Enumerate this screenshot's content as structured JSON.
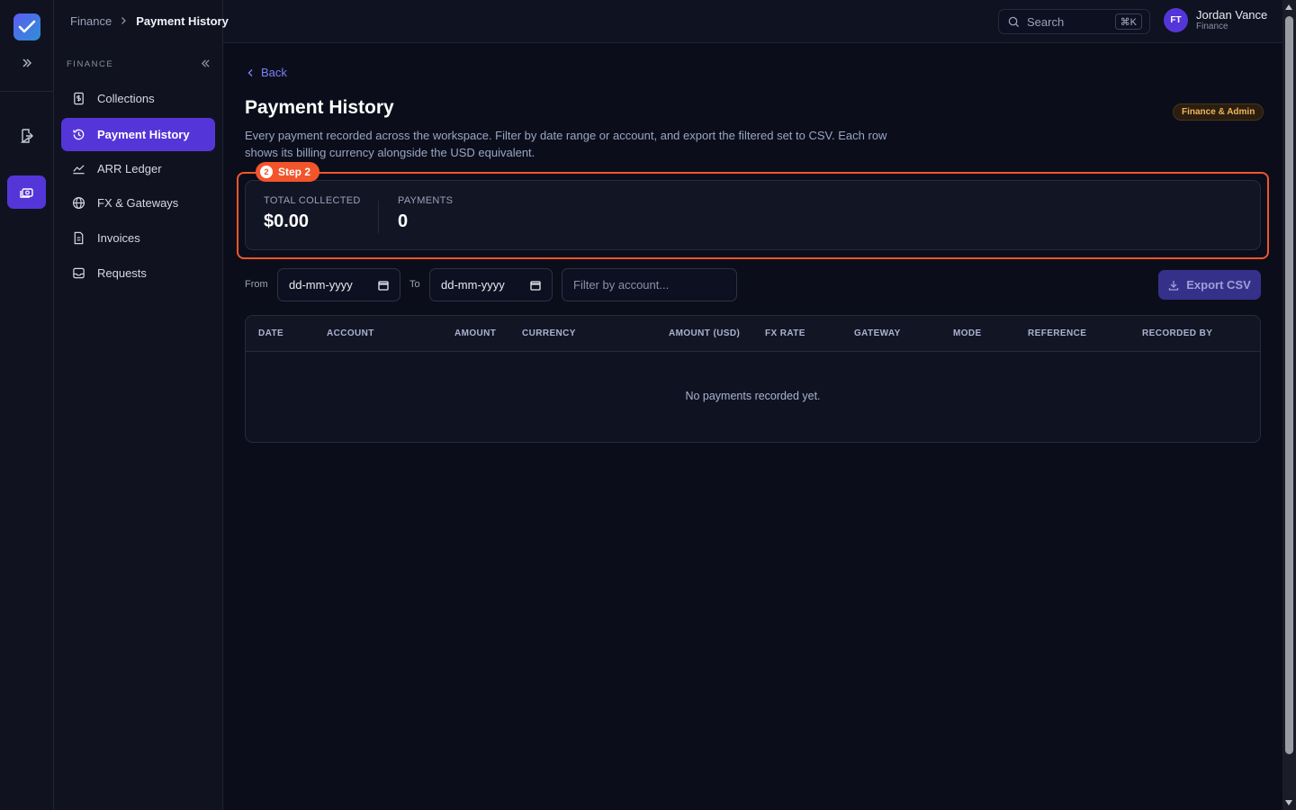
{
  "breadcrumb": {
    "parent": "Finance",
    "separator": ">",
    "current": "Payment History"
  },
  "search": {
    "placeholder": "Search",
    "shortcut": "⌘K"
  },
  "user": {
    "initials": "FT",
    "name": "Jordan Vance",
    "role": "Finance"
  },
  "sidebar": {
    "section": "FINANCE",
    "items": [
      {
        "label": "Collections",
        "icon": "dollar-doc-icon",
        "active": false
      },
      {
        "label": "Payment History",
        "icon": "history-icon",
        "active": true
      },
      {
        "label": "ARR Ledger",
        "icon": "chart-line-icon",
        "active": false
      },
      {
        "label": "FX & Gateways",
        "icon": "globe-icon",
        "active": false
      },
      {
        "label": "Invoices",
        "icon": "invoice-icon",
        "active": false
      },
      {
        "label": "Requests",
        "icon": "inbox-icon",
        "active": false
      }
    ]
  },
  "main": {
    "back_label": "Back",
    "title": "Payment History",
    "role_badge": "Finance & Admin",
    "description": "Every payment recorded across the workspace. Filter by date range or account, and export the filtered set to CSV. Each row shows its billing currency alongside the USD equivalent.",
    "step": {
      "number": "2",
      "label": "Step 2"
    },
    "stats": [
      {
        "label": "TOTAL COLLECTED",
        "value": "$0.00"
      },
      {
        "label": "PAYMENTS",
        "value": "0"
      }
    ],
    "filters": {
      "from_label": "From",
      "from_value": "dd-mm-yyyy",
      "to_label": "To",
      "to_value": "dd-mm-yyyy",
      "account_placeholder": "Filter by account..."
    },
    "export_label": "Export CSV",
    "table": {
      "columns": [
        "DATE",
        "ACCOUNT",
        "AMOUNT",
        "CURRENCY",
        "AMOUNT (USD)",
        "FX RATE",
        "GATEWAY",
        "MODE",
        "REFERENCE",
        "RECORDED BY"
      ],
      "empty_message": "No payments recorded yet."
    }
  },
  "colors": {
    "accent": "#5436d8",
    "step_highlight": "#f2552b",
    "badge_text": "#f2b45a"
  }
}
